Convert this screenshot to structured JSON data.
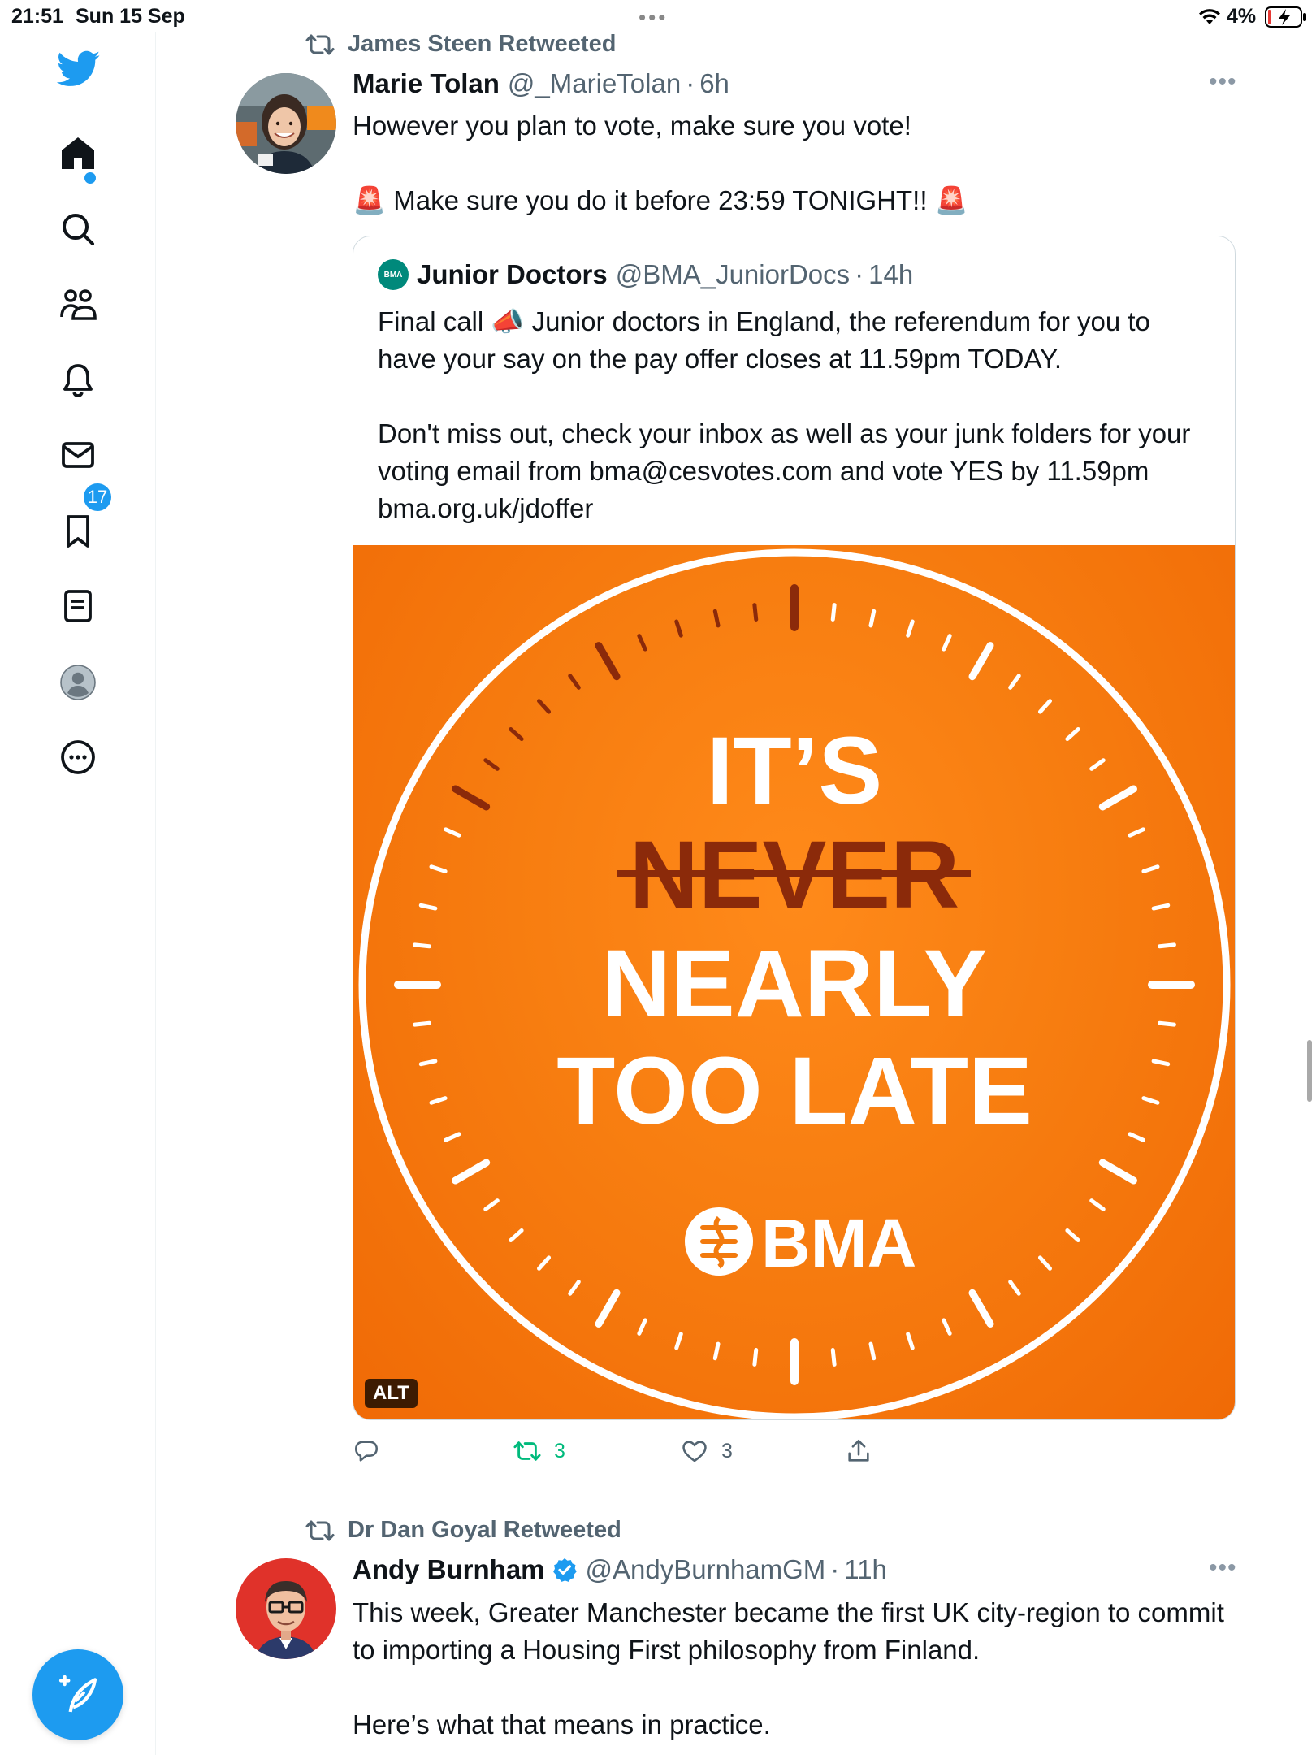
{
  "status_bar": {
    "time": "21:51",
    "date": "Sun 15 Sep",
    "battery_percent": "4%"
  },
  "sidebar": {
    "items": [
      {
        "name": "home",
        "icon": "home-icon"
      },
      {
        "name": "explore",
        "icon": "search-icon"
      },
      {
        "name": "communities",
        "icon": "communities-icon"
      },
      {
        "name": "notifications",
        "icon": "bell-icon",
        "badge": "17"
      },
      {
        "name": "messages",
        "icon": "mail-icon"
      },
      {
        "name": "bookmarks",
        "icon": "bookmark-icon"
      },
      {
        "name": "lists",
        "icon": "lists-icon"
      },
      {
        "name": "profile",
        "icon": "profile-avatar-icon"
      },
      {
        "name": "more",
        "icon": "more-circle-icon"
      }
    ],
    "compose_icon": "compose-feather-icon"
  },
  "tweet1": {
    "retweeted_by": "James Steen Retweeted",
    "name": "Marie Tolan",
    "handle": "@_MarieTolan",
    "sep": "·",
    "time": "6h",
    "text_line1": "However you plan to vote, make sure you vote!",
    "text_line2": "🚨 Make sure you do it before 23:59 TONIGHT!! 🚨",
    "quote": {
      "logo_text": "BMA",
      "name": "Junior Doctors",
      "handle": "@BMA_JuniorDocs",
      "sep": "·",
      "time": "14h",
      "para1": "Final call 📣 Junior doctors in England, the referendum for you to have your say on the pay offer closes at 11.59pm TODAY.",
      "para2": "Don't miss out, check your inbox as well as your junk folders for your voting email from bma@cesvotes.com and vote YES by 11.59pm bma.org.uk/jdoffer",
      "image": {
        "line1": "IT’S",
        "line2": "NEVER",
        "line3": "NEARLY",
        "line4": "TOO LATE",
        "brand": "BMA",
        "alt_label": "ALT",
        "bg_color": "#f77d10"
      }
    },
    "actions": {
      "reply_count": "",
      "retweet_count": "3",
      "like_count": "3"
    }
  },
  "tweet2": {
    "retweeted_by": "Dr Dan Goyal Retweeted",
    "name": "Andy Burnham",
    "handle": "@AndyBurnhamGM",
    "sep": "·",
    "time": "11h",
    "text_line1": "This week, Greater Manchester became the first UK city-region to commit to importing a Housing First philosophy from Finland.",
    "text_line2": "Here’s what that means in practice."
  },
  "colors": {
    "accent": "#1d9bf0",
    "retweet_green": "#00ba7c",
    "secondary_text": "#536471"
  }
}
